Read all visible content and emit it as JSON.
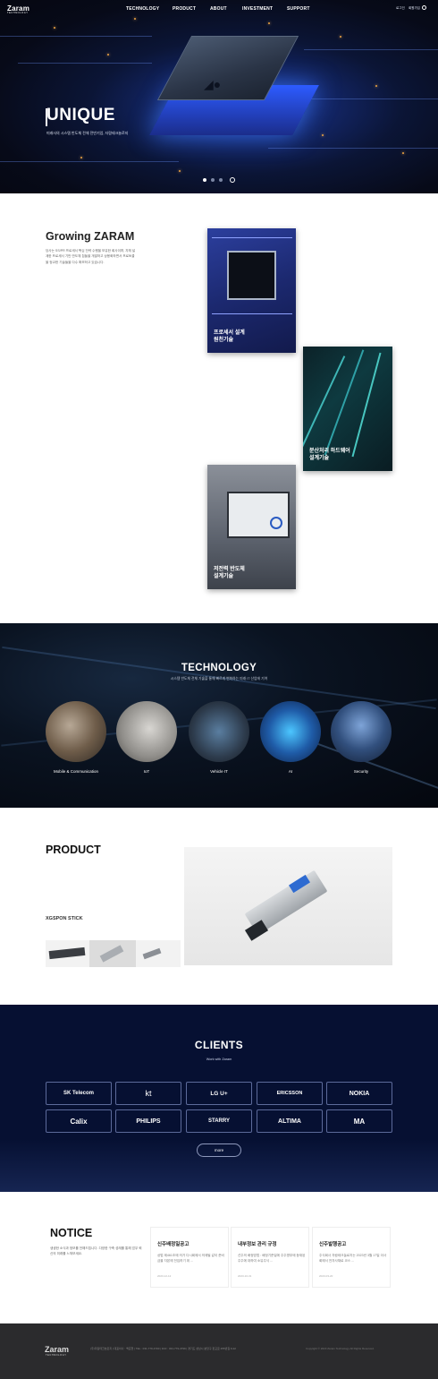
{
  "header": {
    "logo": "Zaram",
    "logo_sub": "TECHNOLOGY",
    "nav": [
      "TECHNOLOGY",
      "PRODUCT",
      "ABOUT",
      "INVESTMENT",
      "SUPPORT"
    ],
    "util_links": [
      "로그인",
      "회원가입"
    ]
  },
  "hero": {
    "title": "UNIQUE",
    "subtitle": "미래사의 시스템 반도체 전체 전반기업, 자람테크놀로지",
    "pager_active": 0
  },
  "growing": {
    "title": "Growing ZARAM",
    "text": "당사는 SS/PR 프로세서 핵심 전략 수행을 보유한 회사이며, 자체 설계한 프로세서 기반 반도체 칩들을 개발하고 상용화하면서 프로토콜을 정교한 기술들을 다수 확보하고 있습니다.",
    "cards": [
      {
        "label": "프로세서 설계\n원천기술"
      },
      {
        "label": "분산처리 하드웨어\n설계기술"
      },
      {
        "label": "저전력 반도체\n설계기술"
      }
    ]
  },
  "technology": {
    "title": "TECHNOLOGY",
    "subtitle": "시스템 반도체 전체 기술을 통해 빠르게 변화하는 미래 IT 산업에 기여",
    "items": [
      {
        "label": "Mobile & Communication"
      },
      {
        "label": "IoT"
      },
      {
        "label": "Vehicle IT"
      },
      {
        "label": "AI"
      },
      {
        "label": "Security"
      }
    ]
  },
  "product": {
    "title": "PRODUCT",
    "name": "XGSPON STICK"
  },
  "clients": {
    "title": "CLIENTS",
    "subtitle": "Work with Zaram",
    "logos": [
      "SK Telecom",
      "kt",
      "LG U+",
      "ERICSSON",
      "NOKIA",
      "Calix",
      "PHILIPS",
      "STARRY",
      "ALTIMA",
      "MA"
    ],
    "more_label": "more"
  },
  "notice": {
    "title": "NOTICE",
    "desc": "생생한 소식과 정보를 전해드립니다. 다양한 구축 성례를 통해 업무 혁신의 미래를 느껴보세요.",
    "items": [
      {
        "title": "신주배정일공고",
        "body": "상법 제461조에 의거 다시회에서 의제될 같이 준비금을 자본에 전입하기 위 ...",
        "date": "2023-12-12"
      },
      {
        "title": "내부정보 관리 규정",
        "body": "선주의 배정방법 : 배정기준일에 주주명부에 등재된 주주에 대하여 소유주식 ...",
        "date": "2023-10-31"
      },
      {
        "title": "신주발행공고",
        "body": "주식회사 자람테크놀로지는 2023년 3월 17일 이사회에서 전자사채로 코스 ...",
        "date": "2023-03-20"
      }
    ]
  },
  "footer": {
    "logo": "Zaram",
    "logo_sub": "TECHNOLOGY",
    "info": "(주)자람테크놀로지 | 대표이사 : 백준현 | TEL : 031-779-4700 | FAX : 031-779-4799 | 경기도 성남시 분당구 판교로 255번길 9-22",
    "copyright": "Copyright © 2023 Zaram Technology All Rights Reserved."
  },
  "colors": {
    "hero_bg": "#070a18",
    "clients_bg": "#061032",
    "footer_bg": "#2b2b2d",
    "chip_glow": "#2d5bff"
  }
}
